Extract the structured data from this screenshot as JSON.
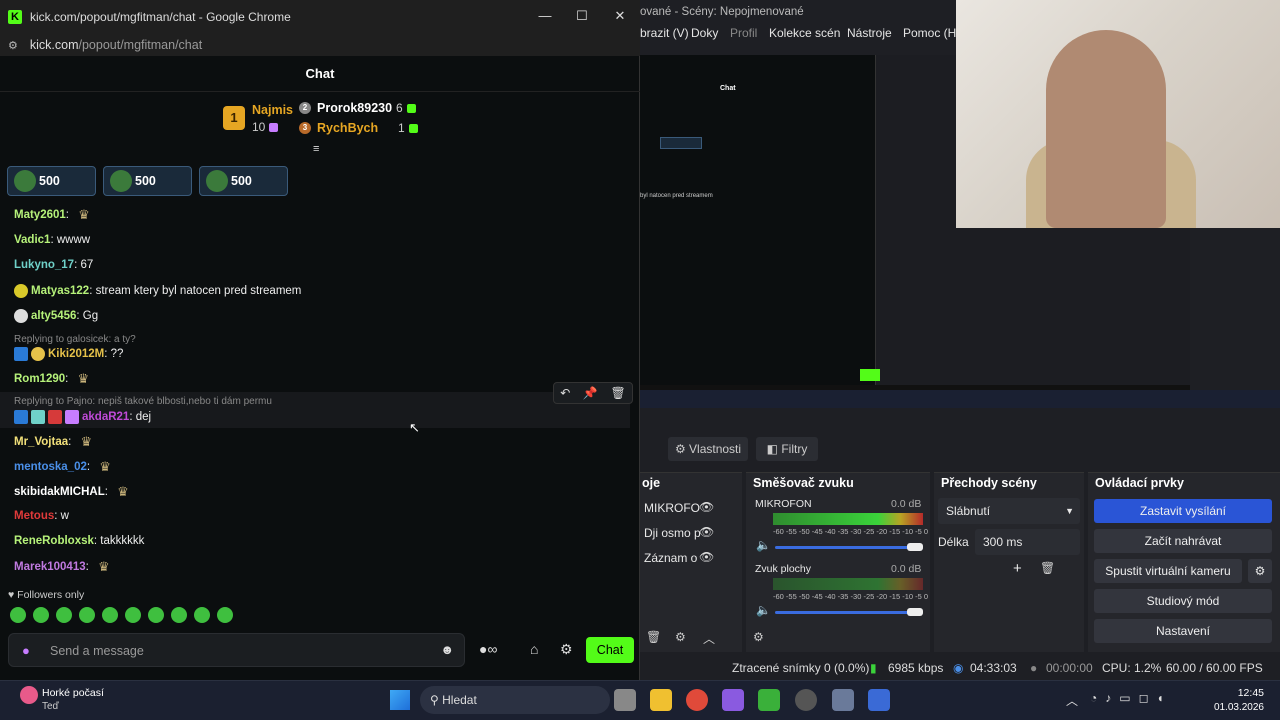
{
  "window": {
    "title": "kick.com/popout/mgfitman/chat - Google Chrome",
    "url_host": "kick.com",
    "url_path": "/popout/mgfitman/chat"
  },
  "chat": {
    "header": "Chat"
  },
  "leaderboard": [
    {
      "rank": "1",
      "name": "Najmis",
      "count": "10",
      "color": "#e6a623"
    },
    {
      "rank": "2",
      "name": "Prorok89230",
      "count": "6",
      "color": "#ffffff"
    },
    {
      "rank": "3",
      "name": "RychBych",
      "count": "1",
      "color": "#e6a623"
    }
  ],
  "pinned_gifts": [
    "500",
    "500",
    "500"
  ],
  "messages": [
    {
      "user": "Maty2601",
      "text": "",
      "color": "#b6f27a",
      "emote": "wings"
    },
    {
      "user": "Vadic1",
      "text": "wwww",
      "color": "#b6f27a"
    },
    {
      "user": "Lukyno_17",
      "text": "67",
      "color": "#6fd1c9"
    },
    {
      "user": "Matyas122",
      "text": "stream ktery byl natocen pred streamem",
      "color": "#b6f27a"
    },
    {
      "user": "alty5456",
      "text": "Gg",
      "color": "#b6f27a"
    },
    {
      "reply": "Replying to galosicek: a ty?",
      "user": "Kiki2012M",
      "text": "??",
      "color": "#e6c24a"
    },
    {
      "user": "Rom1290",
      "text": "",
      "color": "#b6f27a",
      "emote": "wings"
    },
    {
      "reply": "Replying to Pajno: nepiš takové blbosti,nebo ti dám permu",
      "user": "akdaR21",
      "text": "dej",
      "color": "#c04ad8"
    },
    {
      "user": "Mr_Vojtaa",
      "text": "",
      "color": "#f2e07a",
      "emote": "wings"
    },
    {
      "user": "mentoska_02",
      "text": "",
      "color": "#4a8fe8",
      "emote": "wings"
    },
    {
      "user": "skibidakMICHAL",
      "text": "",
      "color": "#ffffff",
      "emote": "wings"
    },
    {
      "user": "Metous",
      "text": "w",
      "color": "#e03a3a"
    },
    {
      "user": "ReneRobloxsk",
      "text": "takkkkkk",
      "color": "#b6f27a"
    },
    {
      "user": "Marek100413",
      "text": "",
      "color": "#c07ae0",
      "emote": "wings"
    }
  ],
  "followers_only": "Followers only",
  "input": {
    "placeholder": "Send a message",
    "send_label": "Chat"
  },
  "obs": {
    "window_title": "ované - Scény: Nepojmenované",
    "menu": [
      "brazit (V)",
      "Doky",
      "Profil",
      "Kolekce scén",
      "Nástroje",
      "Pomoc (H)"
    ],
    "props_tab": "Vlastnosti",
    "filters_tab": "Filtry",
    "sources_head": "oje",
    "sources": [
      "MIKROFO",
      "Dji osmo p",
      "Záznam o"
    ],
    "mixer_head": "Směšovač zvuku",
    "mixer": [
      {
        "name": "MIKROFON",
        "db": "0.0 dB"
      },
      {
        "name": "Zvuk plochy",
        "db": "0.0 dB"
      }
    ],
    "meter_scale": "-60 -55 -50 -45 -40 -35 -30 -25 -20 -15 -10 -5 0",
    "transitions_head": "Přechody scény",
    "transition": "Slábnutí",
    "duration_label": "Délka",
    "duration": "300 ms",
    "controls_head": "Ovládací prvky",
    "controls": [
      "Zastavit vysílání",
      "Začít nahrávat",
      "Spustit virtuální kameru",
      "Studiový mód",
      "Nastavení"
    ],
    "status": {
      "dropped": "Ztracené snímky 0 (0.0%)",
      "kbps": "6985 kbps",
      "stream_time": "04:33:03",
      "rec_time": "00:00:00",
      "cpu": "CPU: 1.2%",
      "fps": "60.00 / 60.00 FPS"
    }
  },
  "taskbar": {
    "weather_title": "Horké počasí",
    "weather_sub": "Teď",
    "search": "Hledat",
    "time": "12:45",
    "date": "01.03.2026"
  },
  "colors": {
    "kick_green": "#53fc18",
    "obs_accent": "#2a55d6"
  }
}
